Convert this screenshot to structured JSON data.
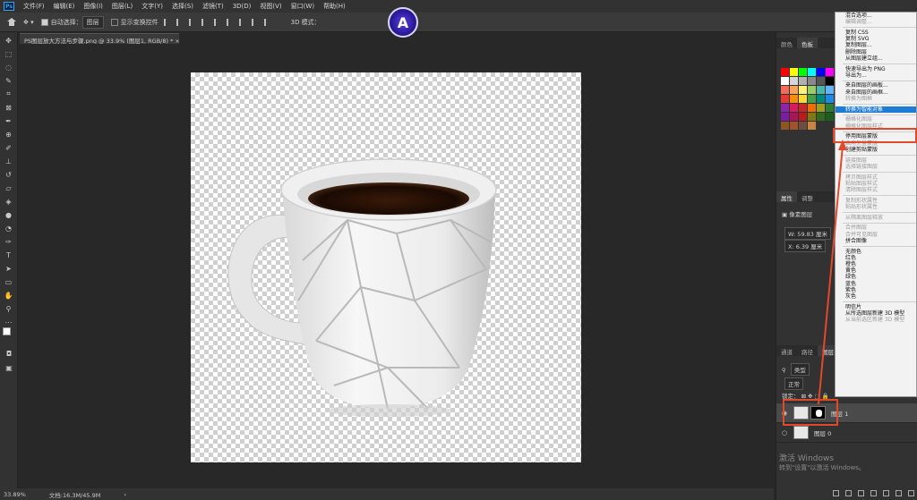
{
  "menubar": {
    "items": [
      "文件(F)",
      "编辑(E)",
      "图像(I)",
      "图层(L)",
      "文字(Y)",
      "选择(S)",
      "滤镜(T)",
      "3D(D)",
      "视图(V)",
      "窗口(W)",
      "帮助(H)"
    ]
  },
  "optbar": {
    "auto_select_label": "自动选择：",
    "auto_select_value": "图层",
    "show_transform_label": "显示变换控件",
    "mode_label": "3D 模式："
  },
  "logo": {
    "letter": "A"
  },
  "document": {
    "tab_title": "PS图层放大方法与步骤.png @ 33.9% (图层1, RGB/8) *"
  },
  "status": {
    "zoom": "33.89%",
    "doc_size": "文档:16.3M/45.9M"
  },
  "panels": {
    "color_tabs": [
      "颜色",
      "色板"
    ],
    "props_tabs": [
      "属性",
      "调整"
    ],
    "props_layer_type": "像素图层",
    "props_w": "W: 59.83 厘米",
    "props_x": "X: 6.39 厘米",
    "layers_tabs": [
      "通道",
      "路径",
      "图层"
    ],
    "layers_filter": "类型",
    "blend_mode": "正常",
    "lock_label": "锁定：",
    "layers": [
      {
        "name": "图层 1",
        "selected": true
      },
      {
        "name": "图层 0",
        "selected": false
      }
    ]
  },
  "watermark": {
    "line1": "激活 Windows",
    "line2": "转到\"设置\"以激活 Windows。"
  },
  "context_menu": {
    "groups": [
      [
        {
          "label": "混合选项...",
          "state": "normal"
        },
        {
          "label": "编辑调整...",
          "state": "disabled"
        }
      ],
      [
        {
          "label": "复制 CSS",
          "state": "normal"
        },
        {
          "label": "复制 SVG",
          "state": "normal"
        },
        {
          "label": "复制图层...",
          "state": "normal"
        },
        {
          "label": "删除图层",
          "state": "normal"
        },
        {
          "label": "从图层建立组...",
          "state": "normal"
        }
      ],
      [
        {
          "label": "快速导出为 PNG",
          "state": "normal"
        },
        {
          "label": "导出为...",
          "state": "normal"
        }
      ],
      [
        {
          "label": "来自图层的画板...",
          "state": "normal"
        },
        {
          "label": "来自图层的画框...",
          "state": "normal"
        },
        {
          "label": "转换为图框",
          "state": "disabled"
        }
      ],
      [
        {
          "label": "转换为智能对象",
          "state": "highlighted"
        }
      ],
      [
        {
          "label": "栅格化图层",
          "state": "disabled"
        },
        {
          "label": "栅格化图层样式",
          "state": "disabled"
        }
      ],
      [
        {
          "label": "停用图层蒙版",
          "state": "normal"
        },
        {
          "label": "启用矢量蒙版",
          "state": "disabled"
        },
        {
          "label": "创建剪贴蒙版",
          "state": "normal"
        }
      ],
      [
        {
          "label": "链接图层",
          "state": "disabled"
        },
        {
          "label": "选择链接图层",
          "state": "disabled"
        }
      ],
      [
        {
          "label": "拷贝图层样式",
          "state": "disabled"
        },
        {
          "label": "粘贴图层样式",
          "state": "disabled"
        },
        {
          "label": "清除图层样式",
          "state": "disabled"
        }
      ],
      [
        {
          "label": "复制形状属性",
          "state": "disabled"
        },
        {
          "label": "粘贴形状属性",
          "state": "disabled"
        }
      ],
      [
        {
          "label": "从隔离图层释放",
          "state": "disabled"
        }
      ],
      [
        {
          "label": "合并图层",
          "state": "disabled"
        },
        {
          "label": "合并可见图层",
          "state": "disabled"
        },
        {
          "label": "拼合图像",
          "state": "normal"
        }
      ],
      [
        {
          "label": "无颜色",
          "state": "normal"
        },
        {
          "label": "红色",
          "state": "normal"
        },
        {
          "label": "橙色",
          "state": "normal"
        },
        {
          "label": "黄色",
          "state": "normal"
        },
        {
          "label": "绿色",
          "state": "normal"
        },
        {
          "label": "蓝色",
          "state": "normal"
        },
        {
          "label": "紫色",
          "state": "normal"
        },
        {
          "label": "灰色",
          "state": "normal"
        }
      ],
      [
        {
          "label": "明信片",
          "state": "normal"
        },
        {
          "label": "从所选图层新建 3D 模型",
          "state": "normal"
        },
        {
          "label": "从当前选区新建 3D 模型",
          "state": "disabled"
        }
      ]
    ]
  },
  "colors": {
    "annotation_red": "#e04a2a",
    "menu_highlight": "#1e7bd6"
  }
}
